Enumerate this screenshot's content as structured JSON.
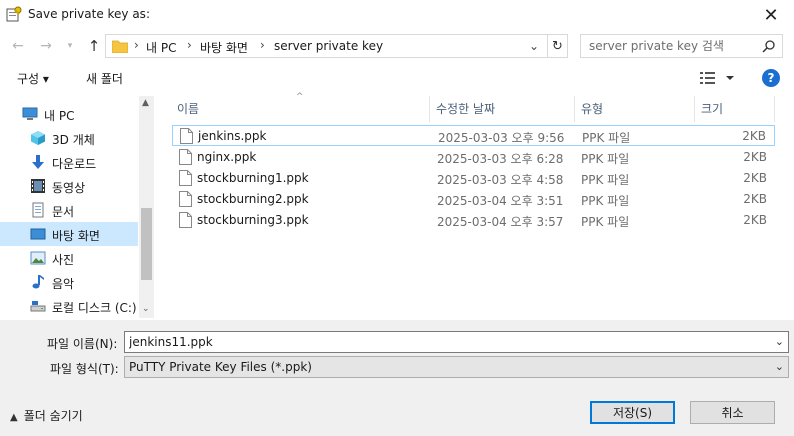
{
  "window": {
    "title": "Save private key as:",
    "close_glyph": "✕",
    "icon": "putty-key-icon"
  },
  "address": {
    "crumbs": [
      "내 PC",
      "바탕 화면",
      "server private key"
    ],
    "search_placeholder": "server private key 검색"
  },
  "toolbar": {
    "organize_label": "구성 ▾",
    "new_folder_label": "새 폴더",
    "help_label": "?"
  },
  "nav": {
    "items": [
      {
        "label": "내 PC",
        "icon": "computer-icon"
      },
      {
        "label": "3D 개체",
        "icon": "cube-3d-icon"
      },
      {
        "label": "다운로드",
        "icon": "download-arrow-icon"
      },
      {
        "label": "동영상",
        "icon": "film-icon"
      },
      {
        "label": "문서",
        "icon": "document-icon"
      },
      {
        "label": "바탕 화면",
        "icon": "desktop-icon",
        "selected": true
      },
      {
        "label": "사진",
        "icon": "picture-icon"
      },
      {
        "label": "음악",
        "icon": "music-note-icon"
      },
      {
        "label": "로컬 디스크 (C:)",
        "icon": "drive-icon"
      }
    ]
  },
  "columns": {
    "name": "이름",
    "modified": "수정한 날짜",
    "type": "유형",
    "size": "크기"
  },
  "files": [
    {
      "name": "jenkins.ppk",
      "modified": "2025-03-03 오후 9:56",
      "type": "PPK 파일",
      "size": "2KB",
      "selected": true
    },
    {
      "name": "nginx.ppk",
      "modified": "2025-03-03 오후 6:28",
      "type": "PPK 파일",
      "size": "2KB"
    },
    {
      "name": "stockburning1.ppk",
      "modified": "2025-03-03 오후 4:58",
      "type": "PPK 파일",
      "size": "2KB"
    },
    {
      "name": "stockburning2.ppk",
      "modified": "2025-03-04 오후 3:51",
      "type": "PPK 파일",
      "size": "2KB"
    },
    {
      "name": "stockburning3.ppk",
      "modified": "2025-03-04 오후 3:57",
      "type": "PPK 파일",
      "size": "2KB"
    }
  ],
  "bottom": {
    "filename_label": "파일 이름(N):",
    "filename_value": "jenkins11.ppk",
    "filetype_label": "파일 형식(T):",
    "filetype_value": "PuTTY Private Key Files (*.ppk)",
    "hide_folders_label": "폴더 숨기기",
    "save_label": "저장(S)",
    "cancel_label": "취소"
  },
  "colors": {
    "selection": "#cce8ff",
    "accent": "#0078d7",
    "help": "#1a6fd0"
  }
}
